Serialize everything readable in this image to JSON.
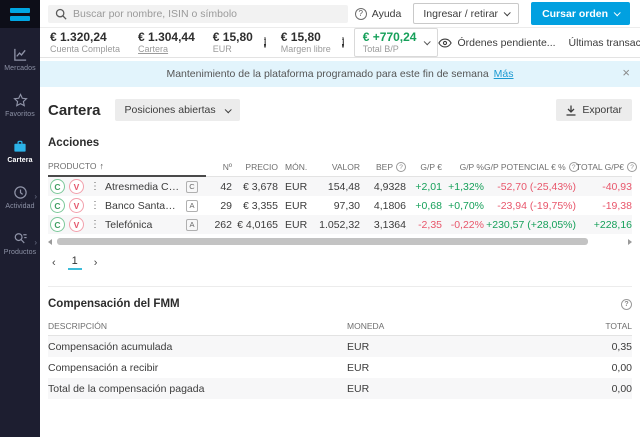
{
  "colors": {
    "accent_blue": "#01a0e0",
    "positive_green": "#16a05a",
    "negative_red": "#e8566b",
    "sidebar_bg": "#1d1e30",
    "banner_bg": "#e2f4fc"
  },
  "topbar": {
    "search_placeholder": "Buscar por nombre, ISIN o símbolo",
    "help_label": "Ayuda",
    "deposit_label": "Ingresar / retirar",
    "order_button_label": "Cursar orden"
  },
  "account_bar": {
    "metrics": [
      {
        "value": "€ 1.320,24",
        "label": "Cuenta Completa"
      },
      {
        "value": "€ 1.304,44",
        "label": "Cartera"
      },
      {
        "value": "€ 15,80",
        "label": "EUR"
      },
      {
        "value": "€ 15,80",
        "label": "Margen libre"
      }
    ],
    "total": {
      "value": "€ +770,24",
      "label": "Total B/P"
    },
    "orders_label": "Órdenes pendiente...",
    "transactions_label": "Últimas transaccion...",
    "info_glyph": "i"
  },
  "sidebar": {
    "items": [
      {
        "label": "Mercados"
      },
      {
        "label": "Favoritos"
      },
      {
        "label": "Cartera"
      },
      {
        "label": "Actividad"
      },
      {
        "label": "Productos"
      }
    ],
    "submenu_chevron": "›"
  },
  "banner": {
    "text": "Mantenimiento de la plataforma programado para este fin de semana",
    "link_label": "Más",
    "close_glyph": "×"
  },
  "portfolio": {
    "title": "Cartera",
    "filter_label": "Posiciones abiertas",
    "export_label": "Exportar",
    "section_title": "Acciones"
  },
  "positions": {
    "columns": {
      "product": "PRODUCTO",
      "qty": "Nº",
      "price": "PRECIO",
      "currency": "MÓN.",
      "value": "VALOR",
      "bep": "BEP",
      "gp_eur": "G/P €",
      "gp_pct": "G/P %",
      "gp_potential": "G/P POTENCIAL € %",
      "gp_total": "TOTAL G/P€"
    },
    "sort_indicator": "↑",
    "actions": {
      "buy": "C",
      "sell": "V",
      "menu": "⋮"
    },
    "help_glyph": "?",
    "rows": [
      {
        "name": "Atresmedia Corporación de Medi...",
        "badge": "C",
        "qty": "42",
        "price": "€ 3,678",
        "currency": "EUR",
        "value": "154,48",
        "bep": "4,9328",
        "gp_eur": "+2,01",
        "gp_pct": "+1,32%",
        "gp_potential": "-52,70 (-25,43%)",
        "gp_total": "-40,93"
      },
      {
        "name": "Banco Santander",
        "badge": "A",
        "qty": "29",
        "price": "€ 3,355",
        "currency": "EUR",
        "value": "97,30",
        "bep": "4,1806",
        "gp_eur": "+0,68",
        "gp_pct": "+0,70%",
        "gp_potential": "-23,94 (-19,75%)",
        "gp_total": "-19,38"
      },
      {
        "name": "Telefónica",
        "badge": "A",
        "qty": "262",
        "price": "€ 4,0165",
        "currency": "EUR",
        "value": "1.052,32",
        "bep": "3,1364",
        "gp_eur": "-2,35",
        "gp_pct": "-0,22%",
        "gp_potential": "+230,57 (+28,05%)",
        "gp_total": "+228,16"
      }
    ]
  },
  "pagination": {
    "prev": "‹",
    "page": "1",
    "next": "›"
  },
  "fmm": {
    "title": "Compensación del FMM",
    "help_glyph": "?",
    "col_desc": "DESCRIPCIÓN",
    "col_currency": "MONEDA",
    "col_total": "TOTAL",
    "rows": [
      {
        "desc": "Compensación acumulada",
        "currency": "EUR",
        "total": "0,35"
      },
      {
        "desc": "Compensación a recibir",
        "currency": "EUR",
        "total": "0,00"
      },
      {
        "desc": "Total de la compensación pagada",
        "currency": "EUR",
        "total": "0,00"
      }
    ]
  }
}
